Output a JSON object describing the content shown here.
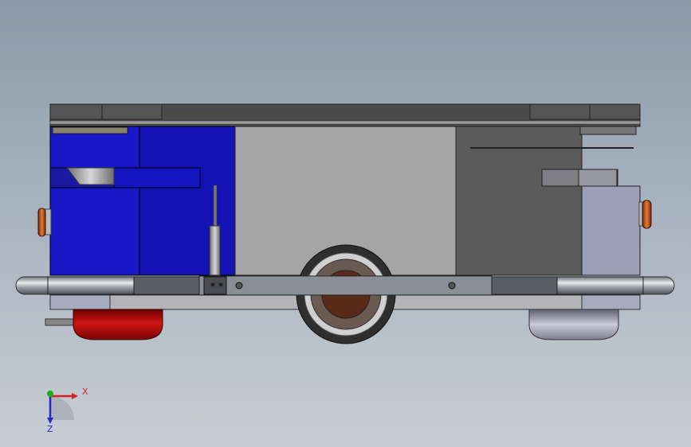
{
  "viewport": {
    "background_top": "#8c99a8",
    "background_bottom": "#c7cdd3"
  },
  "model": {
    "view": "front",
    "colors": {
      "blue_panel": "#1515c9",
      "gray_panel": "#a5a5a5",
      "dark_panel": "#5b5b5b",
      "light_panel": "#9c9fb7",
      "top_plate": "#4b4b4b",
      "bumper": "#8a8f97",
      "red_caster": "#b40a0a",
      "silver_caster": "#a6a8ba",
      "tire": "#3a3a3a",
      "lamp": "#c0521e"
    }
  },
  "triad": {
    "x_label": "X",
    "z_label": "Z",
    "x_color": "#d42020",
    "y_color": "#18b018",
    "z_color": "#2828c8"
  }
}
